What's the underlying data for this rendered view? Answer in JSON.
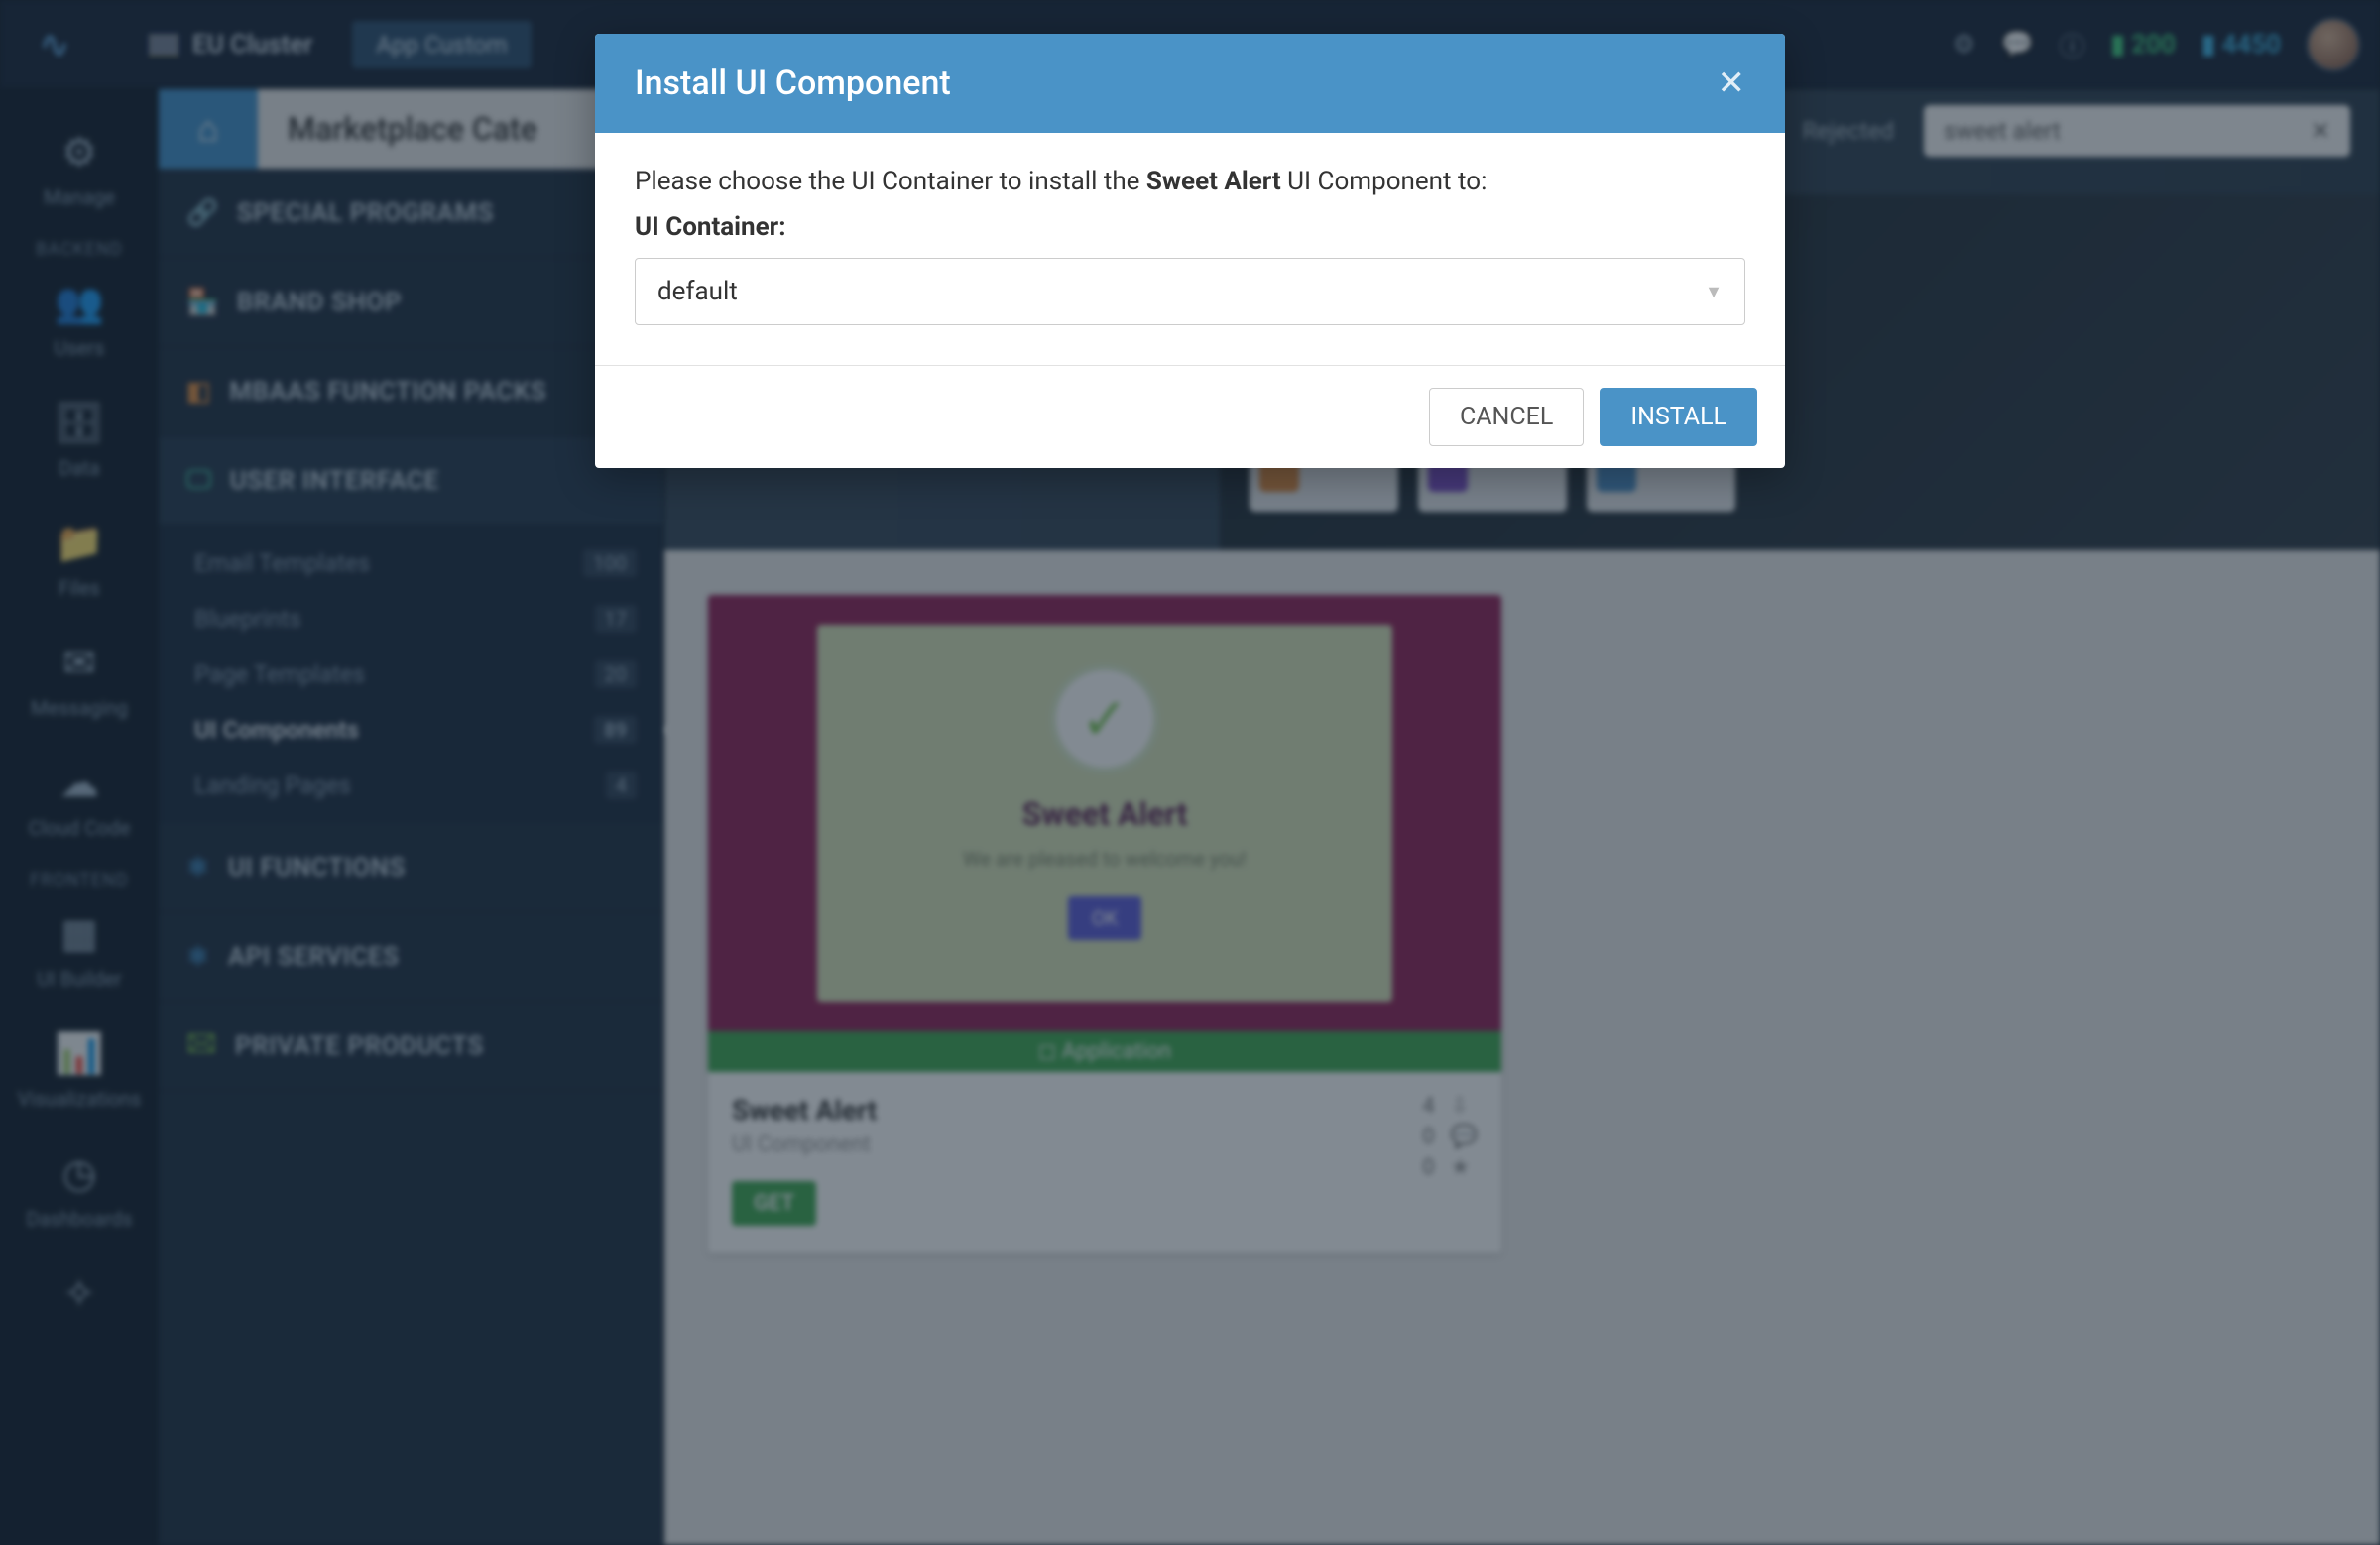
{
  "topbar": {
    "cluster": "EU Cluster",
    "app_label": "App Custom",
    "credits1": "200",
    "credits2": "4450"
  },
  "rail": {
    "manage": "Manage",
    "backend_heading": "BACKEND",
    "users": "Users",
    "data": "Data",
    "files": "Files",
    "messaging": "Messaging",
    "cloudcode": "Cloud Code",
    "frontend_heading": "FRONTEND",
    "uibuilder": "UI Builder",
    "visualizations": "Visualizations",
    "dashboards": "Dashboards"
  },
  "sidebar": {
    "title": "Marketplace Cate",
    "categories": {
      "special": "SPECIAL PROGRAMS",
      "brand": "BRAND SHOP",
      "mbaas": "MBAAS FUNCTION PACKS",
      "ui": "USER INTERFACE",
      "uifunc": "UI FUNCTIONS",
      "api": "API SERVICES",
      "private": "PRIVATE PRODUCTS"
    },
    "subcats": [
      {
        "label": "Email Templates",
        "count": "100"
      },
      {
        "label": "Blueprints",
        "count": "17"
      },
      {
        "label": "Page Templates",
        "count": "20"
      },
      {
        "label": "UI Components",
        "count": "89"
      },
      {
        "label": "Landing Pages",
        "count": "4"
      }
    ]
  },
  "main": {
    "status": "Rejected",
    "search": "sweet alert",
    "card": {
      "title": "Sweet Alert",
      "type": "UI Component",
      "hero_title": "Sweet Alert",
      "hero_sub": "We are pleased to welcome you!",
      "hero_btn": "OK",
      "greenbar": "Application",
      "get": "GET",
      "downloads": "4",
      "reviews": "0",
      "stars": "0"
    }
  },
  "modal": {
    "title": "Install UI Component",
    "instruction_prefix": "Please choose the UI Container to install the ",
    "component_name": "Sweet Alert",
    "instruction_suffix": " UI Component to:",
    "label": "UI Container:",
    "selected": "default",
    "cancel": "CANCEL",
    "install": "INSTALL"
  }
}
